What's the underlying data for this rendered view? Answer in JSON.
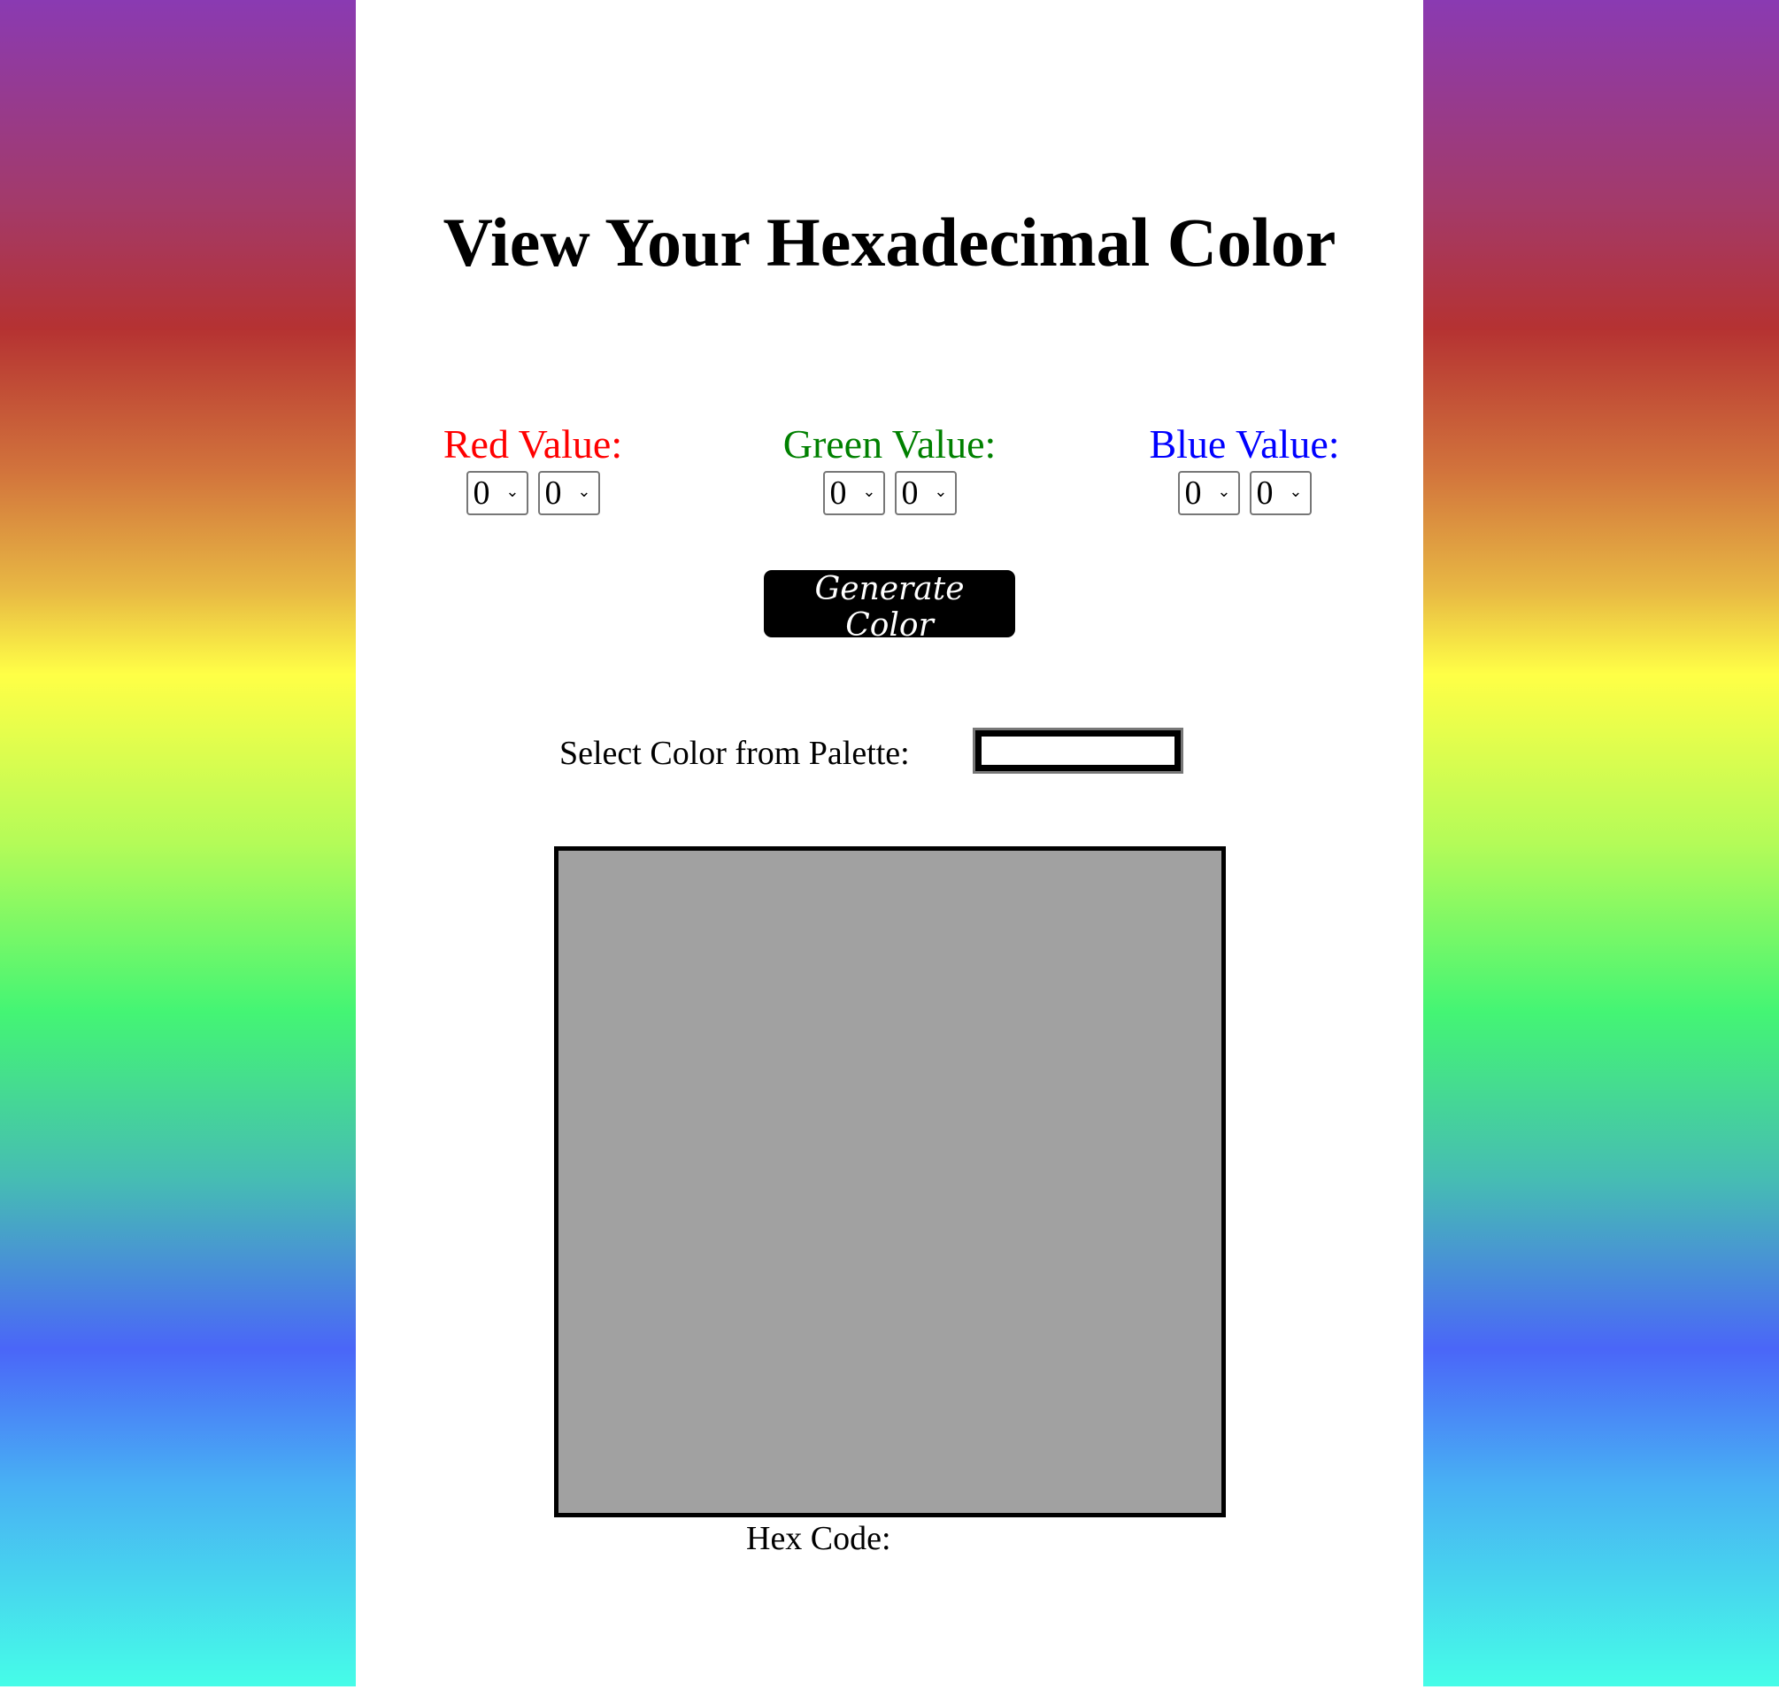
{
  "title": "View Your Hexadecimal Color",
  "groups": [
    {
      "label": "Red Value:",
      "color": "#ff0000",
      "digit1": "0",
      "digit2": "0"
    },
    {
      "label": "Green Value:",
      "color": "#008000",
      "digit1": "0",
      "digit2": "0"
    },
    {
      "label": "Blue Value:",
      "color": "#0000ff",
      "digit1": "0",
      "digit2": "0"
    }
  ],
  "chevron": "⌄",
  "generate_label": "Generate Color",
  "palette_label": "Select Color from Palette:",
  "preview_color": "#a1a1a1",
  "hex_label": "Hex Code:"
}
